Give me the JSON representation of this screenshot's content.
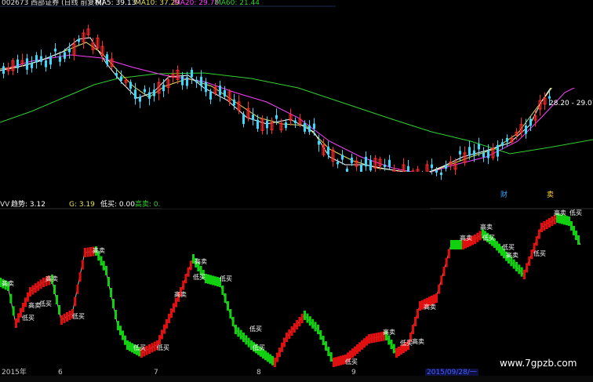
{
  "header": {
    "stock": "002673 西部证券 (日线 前复权)",
    "ma5_label": "MA5: 39.13",
    "ma10_label": "MA10: 37.29",
    "ma20_label": "MA20: 29.78",
    "ma60_label": "MA60: 21.44"
  },
  "price_marks": {
    "range": "28.20 - 29.01",
    "sell_label": "卖"
  },
  "indicator": {
    "name": "VV",
    "trend_label": "趋势: 3.12",
    "g_label": "G: 3.19",
    "low_buy_label": "低买: 0.00",
    "high_sell_label": "高卖: 0.",
    "finance_label": "财",
    "sell_label2": "卖"
  },
  "axis": {
    "year_label": "2015年",
    "months": [
      "6",
      "7",
      "8",
      "9"
    ],
    "current_date": "2015/09/28/一"
  },
  "watermark": "www.7gpzb.com",
  "signals": {
    "buy": "低买",
    "sell": "高卖"
  },
  "colors": {
    "up": "#ff2a2a",
    "down": "#38d8ff",
    "ma5": "#ffffff",
    "ma10": "#e8e060",
    "ma20": "#ff40ff",
    "ma60": "#30d030",
    "ind_up": "#e01010",
    "ind_down": "#10d010"
  }
}
